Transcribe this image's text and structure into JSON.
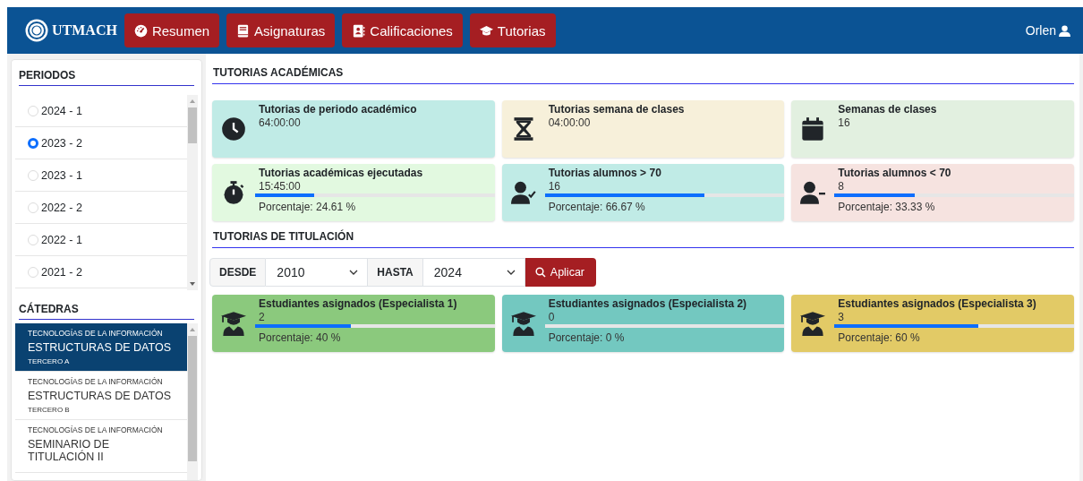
{
  "navbar": {
    "brand": "UTMACH",
    "menu": [
      {
        "label": "Resumen",
        "kind": "gauge"
      },
      {
        "label": "Asignaturas",
        "kind": "book"
      },
      {
        "label": "Calificaciones",
        "kind": "contact"
      },
      {
        "label": "Tutorias",
        "kind": "cap"
      }
    ],
    "user": "Orlen"
  },
  "sidebar": {
    "periods": {
      "title": "PERIODOS",
      "items": [
        {
          "label": "2024 - 1",
          "selected": false
        },
        {
          "label": "2023 - 2",
          "selected": true
        },
        {
          "label": "2023 - 1",
          "selected": false
        },
        {
          "label": "2022 - 2",
          "selected": false
        },
        {
          "label": "2022 - 1",
          "selected": false
        },
        {
          "label": "2021 - 2",
          "selected": false
        }
      ]
    },
    "chairs": {
      "title": "CÁTEDRAS",
      "items": [
        {
          "faculty": "TECNOLOGÍAS DE LA INFORMACIÓN",
          "name": "ESTRUCTURAS DE DATOS",
          "group": "TERCERO A",
          "selected": true
        },
        {
          "faculty": "TECNOLOGÍAS DE LA INFORMACIÓN",
          "name": "ESTRUCTURAS DE DATOS",
          "group": "TERCERO B",
          "selected": false
        },
        {
          "faculty": "TECNOLOGÍAS DE LA INFORMACIÓN",
          "name": "SEMINARIO DE TITULACIÓN II",
          "selected": false
        }
      ]
    }
  },
  "academic": {
    "title": "TUTORIAS ACADÉMICAS",
    "cards": [
      {
        "kind": "clock",
        "title": "Tutorias de periodo académico",
        "value": "64:00:00",
        "color": "#c0ebe6"
      },
      {
        "kind": "hourglass",
        "title": "Tutorias semana de clases",
        "value": "04:00:00",
        "color": "#f7f0da"
      },
      {
        "kind": "calendar",
        "title": "Semanas de clases",
        "value": "16",
        "color": "#e2f0e0"
      },
      {
        "kind": "stopwatch",
        "title": "Tutorias académicas ejecutadas",
        "value": "15:45:00",
        "level": 0.2461,
        "percent": "Porcentaje: 24.61 %",
        "color": "#e2f9e0"
      },
      {
        "kind": "usercheck",
        "title": "Tutorias alumnos > 70",
        "value": "16",
        "level": 0.6667,
        "percent": "Porcentaje: 66.67 %",
        "color": "#c0ebe6"
      },
      {
        "kind": "userminus",
        "title": "Tutorias alumnos < 70",
        "value": "8",
        "level": 0.3333,
        "percent": "Porcentaje: 33.33 %",
        "color": "#f6e3e0"
      }
    ]
  },
  "titulacion": {
    "title": "TUTORIAS DE TITULACIÓN",
    "filter": {
      "from_label": "DESDE",
      "from": "2010",
      "to_label": "HASTA",
      "to": "2024",
      "button": "Aplicar"
    },
    "cards": [
      {
        "kind": "graduate",
        "title": "Estudiantes asignados (Especialista 1)",
        "value": "2",
        "level": 0.4,
        "percent": "Porcentaje: 40 %",
        "color": "#8bc97d"
      },
      {
        "kind": "graduate",
        "title": "Estudiantes asignados (Especialista 2)",
        "value": "0",
        "level": 0,
        "percent": "Porcentaje: 0 %",
        "color": "#73c8c0"
      },
      {
        "kind": "graduate",
        "title": "Estudiantes asignados (Especialista 3)",
        "value": "3",
        "level": 0.6,
        "percent": "Porcentaje: 60 %",
        "color": "#e2ca66"
      }
    ]
  }
}
